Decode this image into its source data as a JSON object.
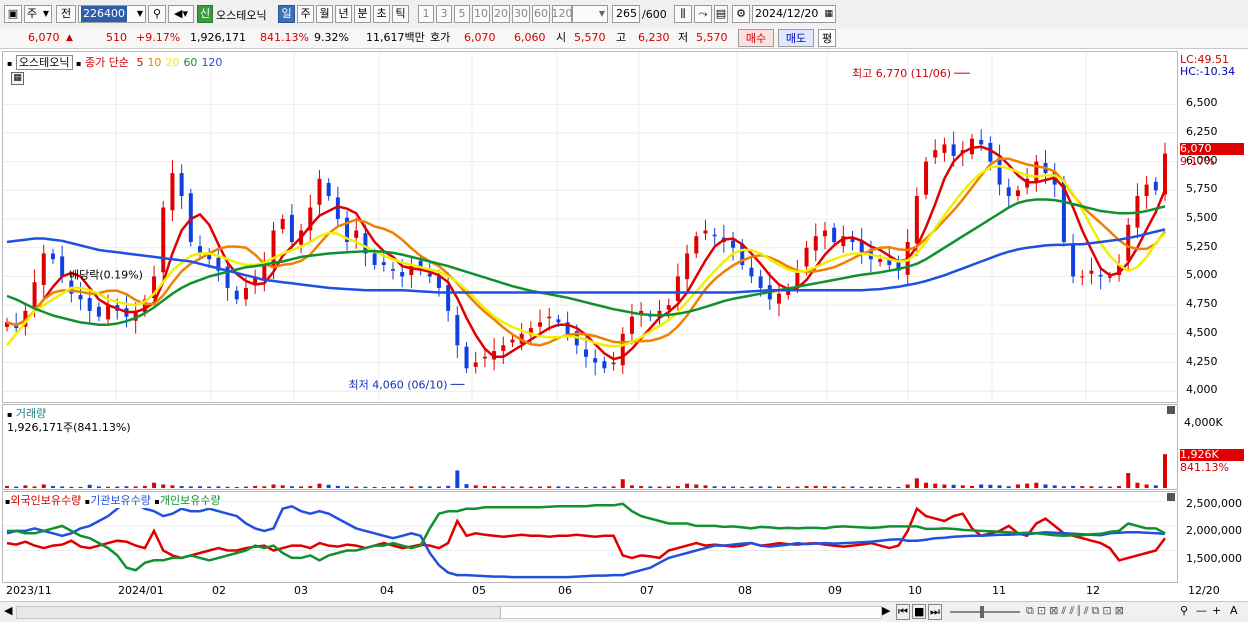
{
  "toolbar": {
    "period_type": "주",
    "prev_label": "전",
    "stock_code": "226400",
    "new_badge": "신",
    "stock_name": "오스테오닉",
    "periods": [
      "일",
      "주",
      "월",
      "년",
      "분",
      "초",
      "틱"
    ],
    "active_period": "일",
    "intervals": [
      "1",
      "3",
      "5",
      "10",
      "20",
      "30",
      "60",
      "120"
    ],
    "count": "265",
    "count_total": "/600",
    "date": "2024/12/20"
  },
  "quote": {
    "price": "6,070",
    "change": "510",
    "change_pct": "+9.17%",
    "volume": "1,926,171",
    "volume_ratio": "841.13%",
    "turnover": "9.32%",
    "amount": "11,617백만",
    "ask_label": "호가",
    "ask1": "6,070",
    "ask2": "6,060",
    "open_label": "시",
    "open": "5,570",
    "high_label": "고",
    "high": "6,230",
    "low_label": "저",
    "low": "5,570",
    "buy_label": "매수",
    "sell_label": "매도",
    "avg_label": "평"
  },
  "price_panel": {
    "legend_name": "오스테오닉",
    "ma_legend_prefix": "종가 단순",
    "ma_periods": [
      "5",
      "10",
      "20",
      "60",
      "120"
    ],
    "ma_colors": [
      "#e00000",
      "#f08000",
      "#f0f000",
      "#109030",
      "#2050e0"
    ],
    "annot_high": "최고 6,770 (11/06)",
    "annot_low": "최저 4,060 (06/10)",
    "annot_dividend": "배당락(0.19%)",
    "lc_label": "LC:49.51",
    "hc_label": "HC:-10.34",
    "current_price_tag": "6,070",
    "current_pct_tag": "9.17%",
    "y_ticks": [
      "6,500",
      "6,250",
      "6,000",
      "5,750",
      "5,500",
      "5,250",
      "5,000",
      "4,750",
      "4,500",
      "4,250",
      "4,000"
    ]
  },
  "volume_panel": {
    "title": "거래량",
    "value": "1,926,171주(841.13%)",
    "y_ticks": [
      "4,000K"
    ],
    "current_tag": "1,926K",
    "current_pct": "841.13%"
  },
  "holdings_panel": {
    "legends": [
      "외국인보유수량",
      "기관보유수량",
      "개인보유수량"
    ],
    "legend_colors": [
      "#e00000",
      "#2050e0",
      "#109030"
    ],
    "y_ticks": [
      "2,500,000",
      "2,000,000",
      "1,500,000"
    ]
  },
  "x_axis": {
    "labels": [
      "2023/11",
      "2024/01",
      "02",
      "03",
      "04",
      "05",
      "06",
      "07",
      "08",
      "09",
      "10",
      "11",
      "12",
      "12/20"
    ]
  },
  "chart_data": {
    "type": "line",
    "price_range": [
      3950,
      6850
    ],
    "close": [
      4600,
      4550,
      4700,
      4950,
      5200,
      5150,
      5000,
      4850,
      4800,
      4700,
      4650,
      4750,
      4700,
      4650,
      4700,
      4800,
      5000,
      5600,
      5900,
      5700,
      5300,
      5200,
      5150,
      5050,
      4900,
      4800,
      4900,
      5000,
      5100,
      5400,
      5500,
      5300,
      5400,
      5600,
      5850,
      5700,
      5500,
      5300,
      5400,
      5200,
      5100,
      5100,
      5050,
      5000,
      5100,
      5050,
      5000,
      4900,
      4700,
      4400,
      4200,
      4250,
      4300,
      4350,
      4400,
      4450,
      4500,
      4550,
      4600,
      4650,
      4600,
      4500,
      4400,
      4300,
      4250,
      4200,
      4250,
      4500,
      4650,
      4700,
      4650,
      4700,
      4750,
      5000,
      5200,
      5350,
      5400,
      5350,
      5300,
      5250,
      5100,
      5000,
      4900,
      4800,
      4850,
      4900,
      5050,
      5250,
      5350,
      5400,
      5300,
      5350,
      5300,
      5200,
      5150,
      5150,
      5100,
      5050,
      5300,
      5700,
      6000,
      6100,
      6150,
      6050,
      6100,
      6200,
      6150,
      6000,
      5800,
      5700,
      5750,
      5850,
      6000,
      5900,
      5800,
      5300,
      5000,
      5000,
      5050,
      5000,
      5000,
      5100,
      5450,
      5700,
      5800,
      5750,
      6070
    ],
    "ma20": [
      4400,
      4500,
      4600,
      4700,
      4750,
      4800,
      4850,
      4900,
      4900,
      4880,
      4850,
      4800,
      4780,
      4760,
      4750,
      4780,
      4850,
      4950,
      5050,
      5120,
      5180,
      5200,
      5200,
      5180,
      5150,
      5120,
      5100,
      5100,
      5120,
      5160,
      5200,
      5230,
      5260,
      5300,
      5350,
      5380,
      5370,
      5330,
      5300,
      5260,
      5220,
      5180,
      5150,
      5120,
      5100,
      5080,
      5060,
      5040,
      5000,
      4950,
      4880,
      4800,
      4720,
      4650,
      4600,
      4560,
      4530,
      4500,
      4480,
      4470,
      4470,
      4480,
      4470,
      4450,
      4420,
      4400,
      4390,
      4400,
      4430,
      4470,
      4520,
      4570,
      4620,
      4690,
      4780,
      4870,
      4960,
      5050,
      5130,
      5200,
      5230,
      5230,
      5200,
      5150,
      5100,
      5060,
      5040,
      5050,
      5080,
      5120,
      5150,
      5180,
      5200,
      5200,
      5190,
      5170,
      5150,
      5130,
      5140,
      5200,
      5300,
      5420,
      5530,
      5640,
      5740,
      5830,
      5900,
      5950,
      5960,
      5940,
      5910,
      5880,
      5870,
      5880,
      5880,
      5830,
      5720,
      5580,
      5430,
      5290,
      5180,
      5100,
      5050,
      5080,
      5170,
      5290,
      5380
    ],
    "ma60": [
      4830,
      4800,
      4760,
      4720,
      4690,
      4660,
      4640,
      4620,
      4600,
      4590,
      4580,
      4580,
      4590,
      4610,
      4640,
      4680,
      4730,
      4790,
      4850,
      4900,
      4940,
      4970,
      5000,
      5020,
      5040,
      5060,
      5080,
      5090,
      5100,
      5120,
      5130,
      5150,
      5170,
      5180,
      5190,
      5200,
      5205,
      5210,
      5215,
      5220,
      5220,
      5215,
      5205,
      5190,
      5170,
      5150,
      5130,
      5110,
      5090,
      5065,
      5040,
      5015,
      4990,
      4965,
      4940,
      4915,
      4895,
      4875,
      4860,
      4845,
      4830,
      4815,
      4795,
      4775,
      4755,
      4735,
      4715,
      4700,
      4685,
      4670,
      4665,
      4660,
      4665,
      4675,
      4690,
      4710,
      4735,
      4760,
      4785,
      4805,
      4820,
      4835,
      4850,
      4865,
      4880,
      4895,
      4910,
      4925,
      4940,
      4955,
      4970,
      4985,
      5000,
      5015,
      5025,
      5035,
      5050,
      5065,
      5085,
      5110,
      5150,
      5200,
      5250,
      5300,
      5350,
      5400,
      5450,
      5500,
      5550,
      5600,
      5640,
      5660,
      5670,
      5670,
      5665,
      5650,
      5630,
      5610,
      5590,
      5570,
      5560,
      5550,
      5550,
      5555,
      5570,
      5590,
      5610
    ],
    "ma120": [
      5300,
      5310,
      5320,
      5330,
      5330,
      5320,
      5310,
      5290,
      5270,
      5250,
      5230,
      5220,
      5210,
      5200,
      5190,
      5180,
      5170,
      5160,
      5150,
      5140,
      5130,
      5110,
      5090,
      5070,
      5050,
      5030,
      5010,
      4990,
      4970,
      4960,
      4950,
      4940,
      4930,
      4920,
      4910,
      4900,
      4895,
      4890,
      4885,
      4880,
      4880,
      4880,
      4880,
      4880,
      4875,
      4870,
      4865,
      4860,
      4860,
      4860,
      4860,
      4860,
      4860,
      4860,
      4860,
      4860,
      4860,
      4860,
      4860,
      4860,
      4860,
      4860,
      4860,
      4860,
      4860,
      4860,
      4860,
      4860,
      4860,
      4860,
      4860,
      4860,
      4860,
      4860,
      4860,
      4860,
      4860,
      4860,
      4860,
      4860,
      4865,
      4870,
      4875,
      4880,
      4880,
      4880,
      4880,
      4880,
      4880,
      4880,
      4880,
      4880,
      4880,
      4880,
      4885,
      4890,
      4900,
      4910,
      4925,
      4940,
      4960,
      4985,
      5010,
      5040,
      5070,
      5100,
      5130,
      5160,
      5190,
      5215,
      5235,
      5250,
      5260,
      5270,
      5275,
      5275,
      5280,
      5280,
      5290,
      5300,
      5310,
      5320,
      5335,
      5350,
      5370,
      5390,
      5410
    ],
    "volume": [
      120,
      80,
      150,
      90,
      200,
      110,
      90,
      70,
      60,
      180,
      90,
      70,
      80,
      100,
      90,
      120,
      300,
      200,
      150,
      110,
      90,
      100,
      80,
      90,
      70,
      60,
      80,
      120,
      100,
      200,
      150,
      100,
      90,
      110,
      250,
      180,
      120,
      90,
      80,
      70,
      60,
      60,
      70,
      80,
      90,
      100,
      90,
      80,
      120,
      1000,
      220,
      150,
      120,
      100,
      90,
      80,
      90,
      70,
      80,
      100,
      90,
      80,
      70,
      60,
      70,
      80,
      90,
      500,
      150,
      110,
      90,
      80,
      90,
      110,
      250,
      200,
      150,
      100,
      90,
      80,
      70,
      80,
      90,
      90,
      80,
      70,
      80,
      110,
      120,
      100,
      90,
      80,
      90,
      70,
      80,
      70,
      70,
      60,
      200,
      550,
      300,
      250,
      200,
      180,
      150,
      120,
      200,
      180,
      150,
      100,
      200,
      250,
      300,
      200,
      150,
      100,
      120,
      110,
      100,
      90,
      80,
      110,
      850,
      300,
      200,
      150,
      1926
    ],
    "volume_range": [
      0,
      4500
    ],
    "foreign": [
      1650,
      1620,
      1680,
      1600,
      1550,
      1600,
      1620,
      1700,
      1580,
      1550,
      1600,
      1650,
      1700,
      1680,
      1600,
      1550,
      1900,
      1500,
      1400,
      1350,
      1400,
      1450,
      1500,
      1550,
      1500,
      1500,
      1550,
      1580,
      1600,
      1500,
      1550,
      1600,
      1600,
      1550,
      1650,
      1600,
      1580,
      1620,
      1600,
      1550,
      1600,
      1650,
      1600,
      1550,
      1580,
      1620,
      1600,
      1550,
      1650,
      2100,
      1800,
      1850,
      1820,
      1800,
      1780,
      1800,
      1820,
      1800,
      1800,
      1780,
      1800,
      1800,
      1820,
      1800,
      1780,
      1800,
      1800,
      1400,
      1350,
      1400,
      1380,
      1350,
      1500,
      1550,
      1600,
      1650,
      1600,
      1620,
      1600,
      1580,
      1600,
      1650,
      1600,
      1620,
      1650,
      1630,
      1620,
      1640,
      1650,
      1620,
      1600,
      1580,
      1600,
      1620,
      1650,
      1600,
      1550,
      1600,
      1900,
      2350,
      2200,
      2150,
      2100,
      2200,
      2250,
      1950,
      1800,
      1850,
      1900,
      2000,
      1850,
      1800,
      2050,
      2150,
      2000,
      1850,
      1800,
      1750,
      1700,
      1650,
      1550,
      1300,
      1350,
      1400,
      1450,
      1500,
      1750
    ],
    "institution": [
      1850,
      1900,
      1900,
      1950,
      1900,
      1850,
      1800,
      1850,
      1950,
      2000,
      2100,
      2200,
      2350,
      2500,
      2450,
      2350,
      2300,
      2200,
      2250,
      2350,
      2300,
      2300,
      2350,
      2300,
      2250,
      2200,
      2050,
      1950,
      1900,
      1950,
      2350,
      2400,
      2300,
      2250,
      2300,
      2250,
      2150,
      2050,
      1950,
      1900,
      1850,
      1800,
      1750,
      1800,
      1850,
      1800,
      1450,
      1200,
      1050,
      1000,
      1000,
      990,
      980,
      970,
      970,
      960,
      960,
      960,
      960,
      960,
      960,
      960,
      970,
      980,
      990,
      990,
      1000,
      1000,
      1050,
      1100,
      1150,
      1250,
      1350,
      1400,
      1450,
      1500,
      1550,
      1600,
      1600,
      1620,
      1640,
      1650,
      1600,
      1580,
      1600,
      1620,
      1650,
      1630,
      1640,
      1650,
      1640,
      1650,
      1660,
      1670,
      1680,
      1700,
      1720,
      1730,
      1700,
      1700,
      1720,
      1750,
      1760,
      1780,
      1790,
      1800,
      1800,
      1810,
      1820,
      1820,
      1830,
      1830,
      1850,
      1870,
      1860,
      1850,
      1840,
      1830,
      1820,
      1810,
      1850,
      1860,
      1870,
      1870,
      1860,
      1850,
      1840
    ],
    "individual": [
      1900,
      1900,
      1850,
      1850,
      1900,
      1950,
      2000,
      1900,
      1800,
      1750,
      1650,
      1550,
      1400,
      1150,
      1100,
      1250,
      1300,
      1300,
      1350,
      1350,
      1400,
      1350,
      1300,
      1350,
      1400,
      1450,
      1500,
      1600,
      1550,
      1600,
      1450,
      1350,
      1350,
      1400,
      1300,
      1400,
      1450,
      1500,
      1500,
      1550,
      1600,
      1600,
      1650,
      1600,
      1550,
      1600,
      1950,
      2250,
      2300,
      2300,
      2350,
      2350,
      2380,
      2380,
      2380,
      2380,
      2380,
      2380,
      2380,
      2390,
      2400,
      2400,
      2400,
      2400,
      2420,
      2420,
      2420,
      2450,
      2300,
      2200,
      2150,
      2100,
      2050,
      2050,
      2050,
      2000,
      2000,
      2000,
      1980,
      1990,
      1970,
      1950,
      1980,
      1970,
      1950,
      1960,
      1950,
      1960,
      1960,
      1950,
      1980,
      1990,
      1980,
      1970,
      1960,
      1970,
      1990,
      1990,
      1990,
      1990,
      1940,
      1940,
      1950,
      1940,
      1920,
      1910,
      1900,
      1890,
      1880,
      1870,
      1850,
      1860,
      1850,
      1830,
      1810,
      1800,
      1810,
      1810,
      1830,
      1840,
      1880,
      1900,
      2050,
      2000,
      1950,
      1950,
      1850
    ],
    "holdings_range": [
      900,
      2650
    ]
  }
}
